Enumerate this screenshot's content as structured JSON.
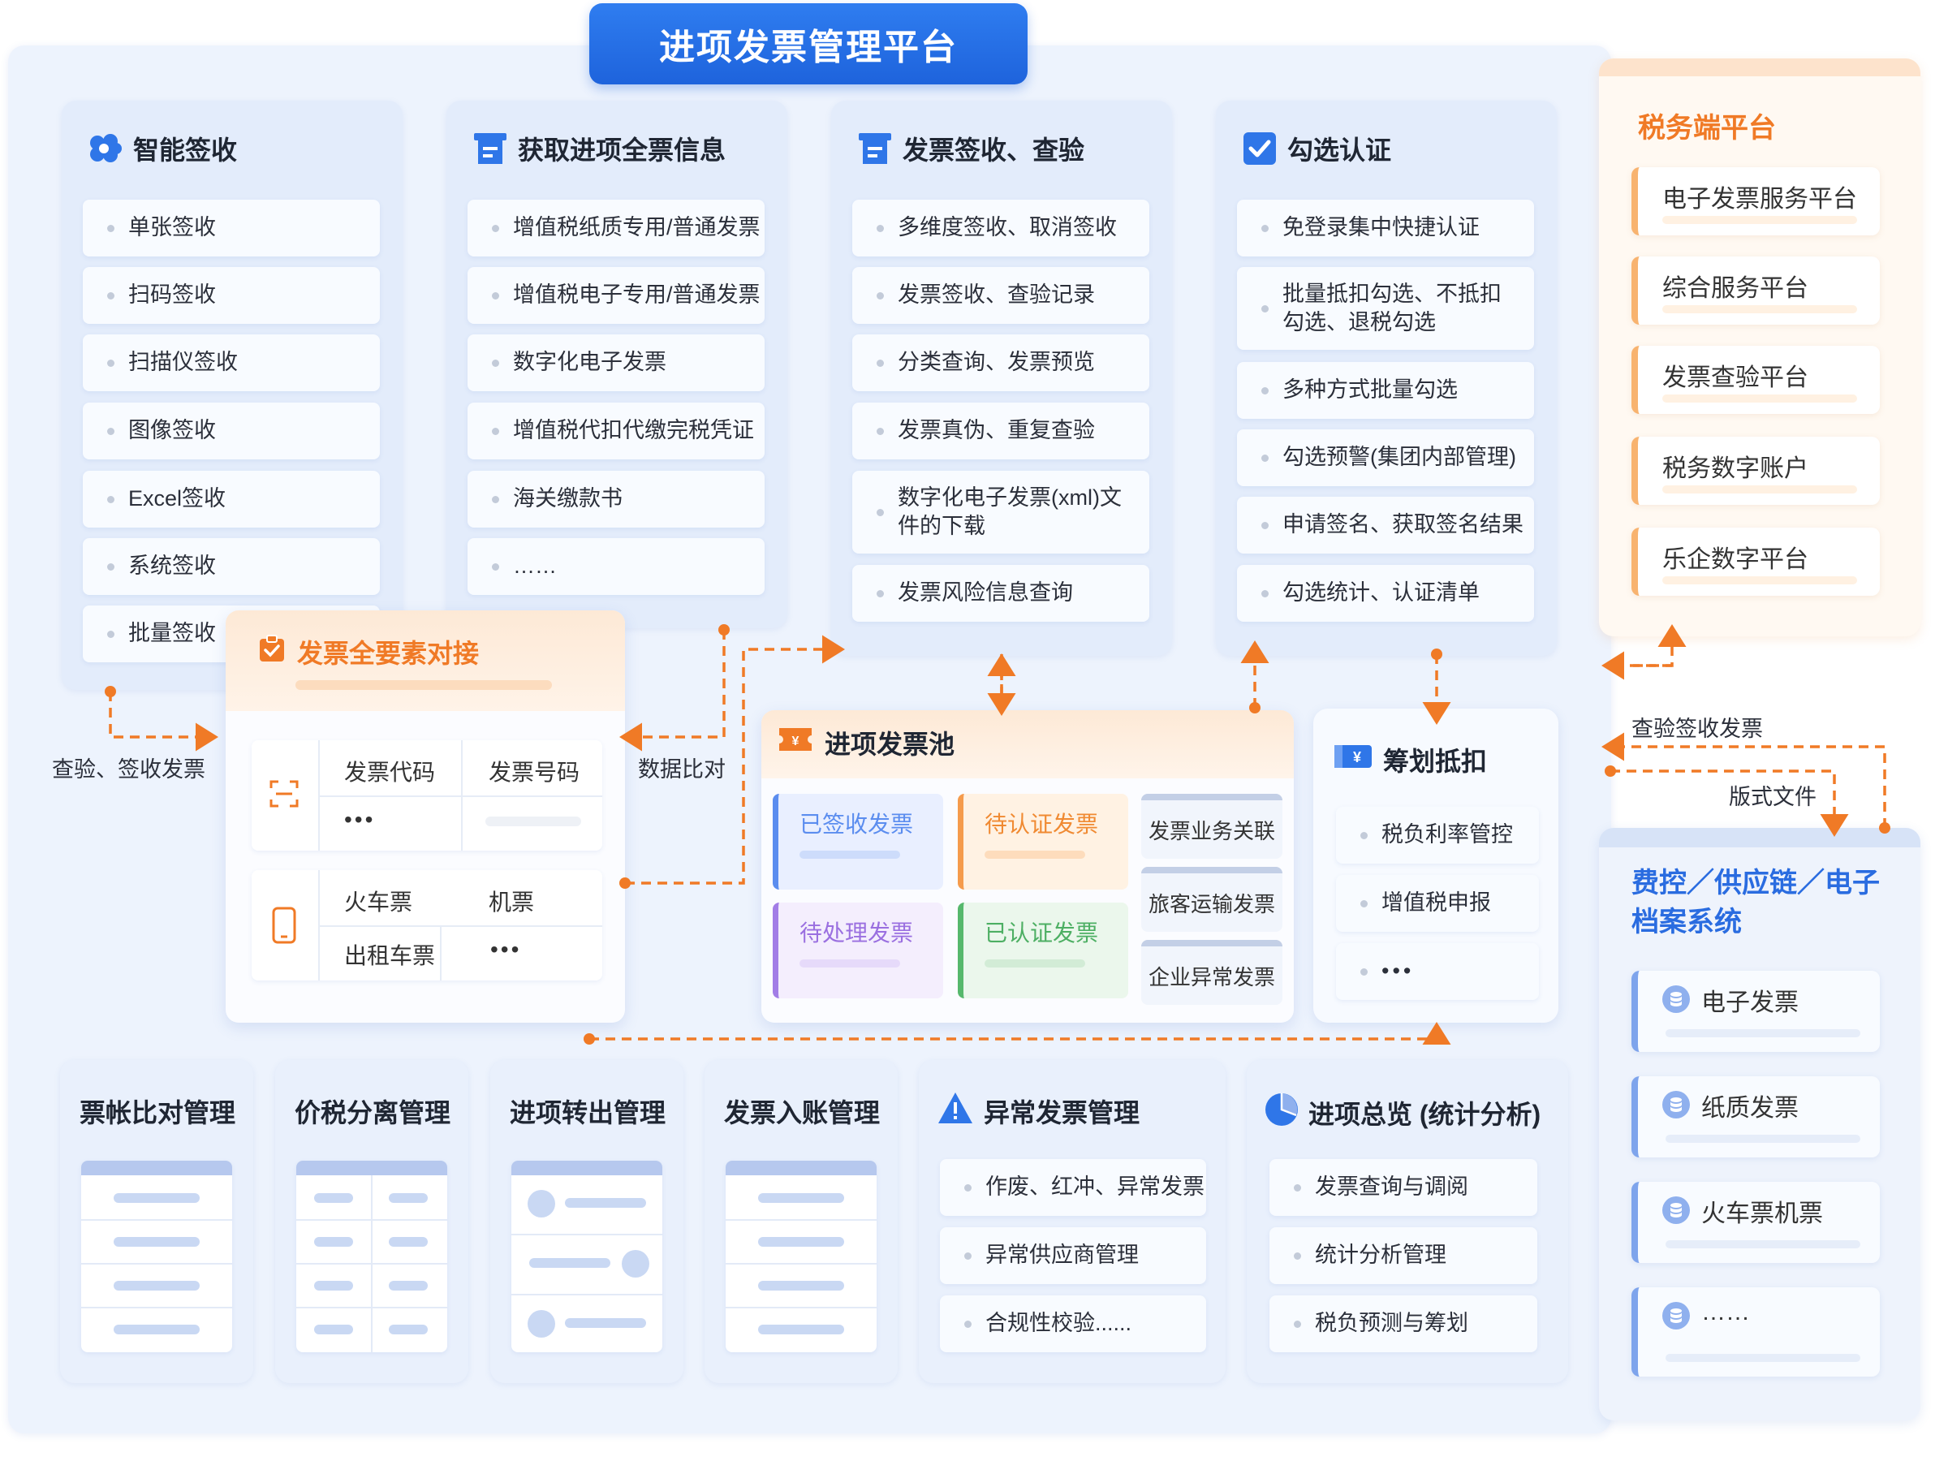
{
  "main_title": "进项发票管理平台",
  "colors": {
    "primary": "#1e63dc",
    "accent_orange": "#f07a26",
    "flow_line": "#f07a26"
  },
  "smart_receipt": {
    "title": "智能签收",
    "icon": "cloud-cluster-icon",
    "items": [
      "单张签收",
      "扫码签收",
      "扫描仪签收",
      "图像签收",
      "Excel签收",
      "系统签收",
      "批量签收"
    ]
  },
  "full_invoice_info": {
    "title": "获取进项全票信息",
    "icon": "document-icon",
    "items": [
      "增值税纸质专用/普通发票",
      "增值税电子专用/普通发票",
      "数字化电子发票",
      "增值税代扣代缴完税凭证",
      "海关缴款书",
      "……"
    ]
  },
  "verify": {
    "title": "发票签收、查验",
    "icon": "document-icon",
    "items": [
      "多维度签收、取消签收",
      "发票签收、查验记录",
      "分类查询、发票预览",
      "发票真伪、重复查验",
      "数字化电子发票(xml)文件的下载",
      "发票风险信息查询"
    ]
  },
  "check_auth": {
    "title": "勾选认证",
    "icon": "checkbox-icon",
    "items": [
      "免登录集中快捷认证",
      "批量抵扣勾选、不抵扣勾选、退税勾选",
      "多种方式批量勾选",
      "勾选预警(集团内部管理)",
      "申请签名、获取签名结果",
      "勾选统计、认证清单"
    ]
  },
  "tax_platform": {
    "title": "税务端平台",
    "items": [
      "电子发票服务平台",
      "综合服务平台",
      "发票查验平台",
      "税务数字账户",
      "乐企数字平台"
    ]
  },
  "flow_labels": {
    "verify_receipt": "查验、签收发票",
    "data_compare": "数据比对",
    "check_receipt": "查验签收发票",
    "format_file": "版式文件"
  },
  "element_dock": {
    "title": "发票全要素对接",
    "row1": {
      "col1": "发票代码",
      "col2": "发票号码",
      "more": "•••"
    },
    "row2": {
      "col1": "火车票",
      "col2": "机票",
      "col3": "出租车票",
      "more": "•••"
    }
  },
  "invoice_pool": {
    "title": "进项发票池",
    "boxes": [
      {
        "label": "已签收发票",
        "color": "#5b8def"
      },
      {
        "label": "待认证发票",
        "color": "#f59b4c"
      },
      {
        "label": "待处理发票",
        "color": "#a27de6"
      },
      {
        "label": "已认证发票",
        "color": "#56b86c"
      }
    ],
    "side": [
      "发票业务关联",
      "旅客运输发票",
      "企业异常发票"
    ]
  },
  "planning": {
    "title": "筹划抵扣",
    "items": [
      "税负利率管控",
      "增值税申报",
      "•••"
    ]
  },
  "systems": {
    "title": "费控／供应链／电子档案系统",
    "items": [
      "电子发票",
      "纸质发票",
      "火车票机票",
      "……"
    ]
  },
  "bottom": {
    "reconcile": "票帐比对管理",
    "price_tax": "价税分离管理",
    "transfer_out": "进项转出管理",
    "posting": "发票入账管理",
    "abnormal": {
      "title": "异常发票管理",
      "items": [
        "作废、红冲、异常发票",
        "异常供应商管理",
        "合规性校验......"
      ]
    },
    "overview": {
      "title": "进项总览 (统计分析)",
      "items": [
        "发票查询与调阅",
        "统计分析管理",
        "税负预测与筹划"
      ]
    }
  }
}
